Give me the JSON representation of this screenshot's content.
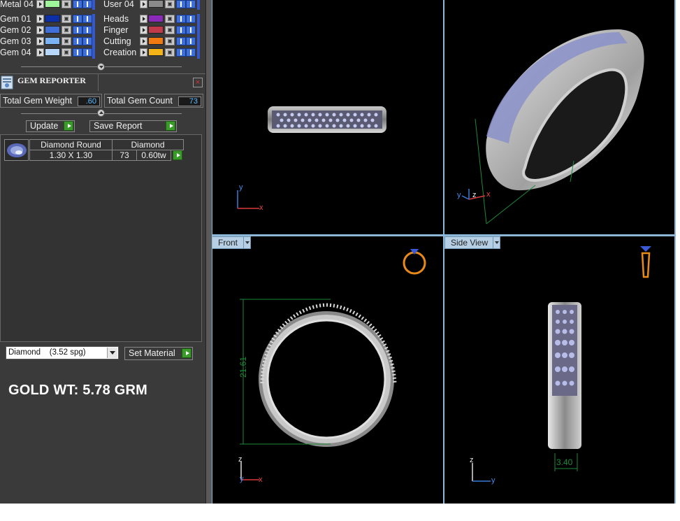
{
  "layers": {
    "left": [
      {
        "name": "Metal 04",
        "color": "#9ef59a"
      },
      {
        "name": "Gem 01",
        "color": "#0c2fa8"
      },
      {
        "name": "Gem 02",
        "color": "#3f6fd8"
      },
      {
        "name": "Gem 03",
        "color": "#7ab4f6"
      },
      {
        "name": "Gem 04",
        "color": "#b6d6fa"
      }
    ],
    "right": [
      {
        "name": "User 04",
        "color": "#8a8a8a"
      },
      {
        "name": "Heads",
        "color": "#8a2ab8"
      },
      {
        "name": "Finger",
        "color": "#c03a4a"
      },
      {
        "name": "Cutting",
        "color": "#f07a10"
      },
      {
        "name": "Creation",
        "color": "#f4b418"
      }
    ]
  },
  "gem_reporter": {
    "title": "GEM REPORTER",
    "close_label": "×",
    "total_gem_weight_label": "Total Gem Weight",
    "total_gem_weight": ".60",
    "total_gem_count_label": "Total Gem Count",
    "total_gem_count": "73",
    "update_label": "Update",
    "save_report_label": "Save Report",
    "row": {
      "shape": "Diamond Round",
      "size": "1.30 X 1.30",
      "material": "Diamond",
      "count": "73",
      "weight": "0.60tw"
    }
  },
  "material_select": "Diamond    (3.52 spg)",
  "set_material_label": "Set Material",
  "gold_weight_text": "GOLD WT: 5.78 GRM",
  "viewports": {
    "front_label": "Front",
    "side_label": "Side View",
    "front_dimension": "21.61",
    "side_dimension": "3.40",
    "axes": {
      "x": "x",
      "y": "y",
      "z": "z"
    }
  },
  "colors": {
    "accent_blue": "#3f6fd8",
    "viewport_border": "#8fb8d8",
    "dimension_green": "#1e8a3a",
    "value_text": "#5ab8ff",
    "play_green": "#3a9a2a"
  }
}
